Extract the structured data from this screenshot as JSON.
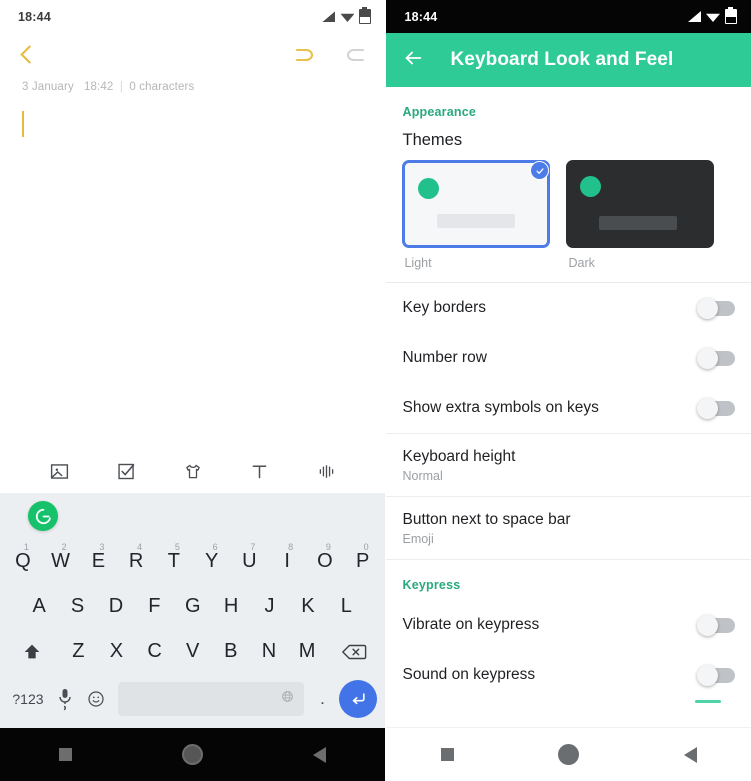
{
  "left_phone": {
    "statusbar": {
      "time": "18:44",
      "icons": [
        "signal-icon",
        "wifi-icon",
        "battery-icon"
      ]
    },
    "toolbar": {
      "back_icon": "chevron-left-icon",
      "undo_icon": "undo-icon",
      "redo_icon": "redo-icon",
      "undo_color": "#e8b93b",
      "redo_color": "#cfcfcf"
    },
    "note": {
      "date": "3 January",
      "time": "18:42",
      "separator": "|",
      "char_count": "0 characters",
      "body_text": ""
    },
    "media_strip": [
      {
        "name": "image-icon",
        "label": "Image"
      },
      {
        "name": "checklist-icon",
        "label": "Checklist"
      },
      {
        "name": "sticker-shirt-icon",
        "label": "Sticker"
      },
      {
        "name": "text-format-icon",
        "label": "Text"
      },
      {
        "name": "audio-waveform-icon",
        "label": "Audio"
      }
    ],
    "keyboard": {
      "suggestion_logo": "grammarly-logo-icon",
      "logo_color": "#15c26b",
      "row1": [
        {
          "key": "Q",
          "num": "1"
        },
        {
          "key": "W",
          "num": "2"
        },
        {
          "key": "E",
          "num": "3"
        },
        {
          "key": "R",
          "num": "4"
        },
        {
          "key": "T",
          "num": "5"
        },
        {
          "key": "Y",
          "num": "6"
        },
        {
          "key": "U",
          "num": "7"
        },
        {
          "key": "I",
          "num": "8"
        },
        {
          "key": "O",
          "num": "9"
        },
        {
          "key": "P",
          "num": "0"
        }
      ],
      "row2": [
        "A",
        "S",
        "D",
        "F",
        "G",
        "H",
        "J",
        "K",
        "L"
      ],
      "row3": [
        "Z",
        "X",
        "C",
        "V",
        "B",
        "N",
        "M"
      ],
      "shift_icon": "shift-arrow-icon",
      "backspace_icon": "backspace-icon",
      "symbols_key": "?123",
      "mic_icon": "microphone-comma-icon",
      "emoji_key": "☺",
      "space_globe_icon": "globe-language-icon",
      "period_key": ".",
      "enter_icon": "enter-return-icon",
      "enter_color": "#4274e8"
    },
    "navbar": [
      {
        "name": "recents-button",
        "icon": "square-icon"
      },
      {
        "name": "home-button",
        "icon": "circle-icon"
      },
      {
        "name": "back-button",
        "icon": "triangle-left-icon"
      }
    ]
  },
  "right_phone": {
    "statusbar": {
      "time": "18:44",
      "icons": [
        "signal-icon",
        "wifi-icon",
        "battery-icon"
      ]
    },
    "appbar": {
      "back_icon": "arrow-left-icon",
      "title": "Keyboard Look and Feel",
      "bg_color": "#2ecb96"
    },
    "sections": {
      "appearance_label": "Appearance",
      "keypress_label": "Keypress"
    },
    "themes": {
      "title": "Themes",
      "options": [
        {
          "label": "Light",
          "selected": true,
          "accent": "#22c08a",
          "bg": "#f6f7f9",
          "border": "#4d7ce8"
        },
        {
          "label": "Dark",
          "selected": false,
          "accent": "#22c08a",
          "bg": "#2b2d2f",
          "border": "#2b2d2f"
        }
      ],
      "check_icon": "check-icon"
    },
    "settings": [
      {
        "title": "Key borders",
        "type": "toggle",
        "value": "off"
      },
      {
        "title": "Number row",
        "type": "toggle",
        "value": "off"
      },
      {
        "title": "Show extra symbols on keys",
        "type": "toggle",
        "value": "off"
      }
    ],
    "settings_values": [
      {
        "title": "Keyboard height",
        "subtitle": "Normal"
      },
      {
        "title": "Button next to space bar",
        "subtitle": "Emoji"
      }
    ],
    "keypress_settings": [
      {
        "title": "Vibrate on keypress",
        "type": "toggle",
        "value": "off"
      },
      {
        "title": "Sound on keypress",
        "type": "toggle",
        "value": "off"
      }
    ],
    "navbar": [
      {
        "name": "recents-button",
        "icon": "square-icon"
      },
      {
        "name": "home-button",
        "icon": "circle-icon"
      },
      {
        "name": "back-button",
        "icon": "triangle-left-icon"
      }
    ]
  }
}
